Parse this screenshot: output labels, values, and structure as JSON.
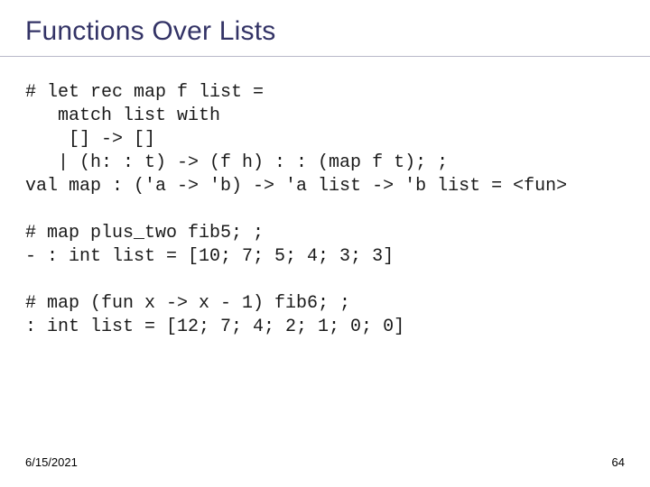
{
  "title": "Functions Over Lists",
  "code": "# let rec map f list =\n   match list with\n    [] -> []\n   | (h: : t) -> (f h) : : (map f t); ;\nval map : ('a -> 'b) -> 'a list -> 'b list = <fun>\n\n# map plus_two fib5; ;\n- : int list = [10; 7; 5; 4; 3; 3]\n\n# map (fun x -> x - 1) fib6; ;\n: int list = [12; 7; 4; 2; 1; 0; 0]",
  "footer": {
    "date": "6/15/2021",
    "page": "64"
  }
}
